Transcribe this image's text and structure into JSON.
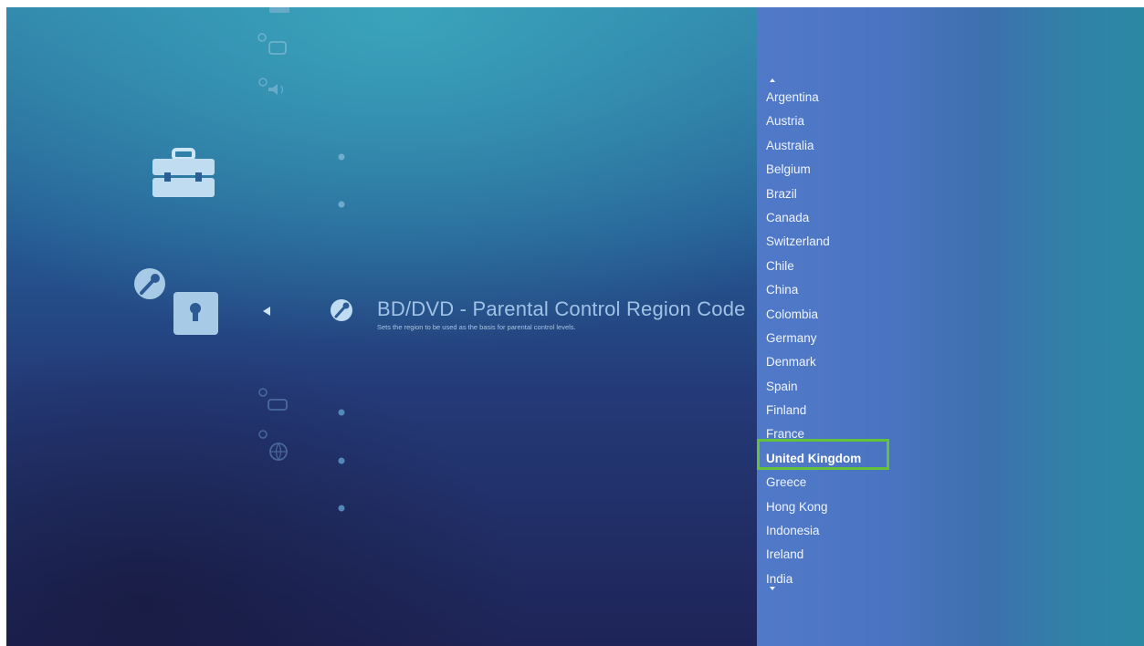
{
  "setting": {
    "title": "BD/DVD - Parental Control Region Code",
    "description": "Sets the region to be used as the basis for parental control levels."
  },
  "region_list": {
    "items": [
      "Argentina",
      "Austria",
      "Australia",
      "Belgium",
      "Brazil",
      "Canada",
      "Switzerland",
      "Chile",
      "China",
      "Colombia",
      "Germany",
      "Denmark",
      "Spain",
      "Finland",
      "France",
      "United Kingdom",
      "Greece",
      "Hong Kong",
      "Indonesia",
      "Ireland",
      "India"
    ],
    "selected": "United Kingdom",
    "scroll_up_icon": "triangle-up-icon",
    "scroll_down_icon": "triangle-down-icon"
  },
  "icons": {
    "category": "toolbox-icon",
    "section": "wrench-lock-icon",
    "back": "triangle-left-icon",
    "setting": "wrench-icon"
  },
  "colors": {
    "selection_outline": "#63c13a",
    "list_text": "#eef4ff",
    "title_text": "#9fc2e6"
  }
}
